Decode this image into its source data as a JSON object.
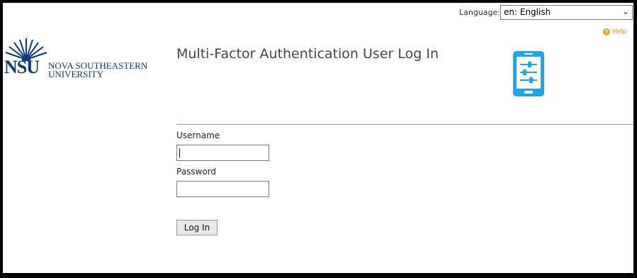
{
  "language": {
    "label": "Language:",
    "selected": "en: English"
  },
  "help": {
    "label": "Help"
  },
  "logo": {
    "abbr": "NSU",
    "line1": "NOVA SOUTHEASTERN",
    "line2": "UNIVERSITY"
  },
  "page": {
    "title": "Multi-Factor Authentication User Log In"
  },
  "form": {
    "username_label": "Username",
    "username_value": "",
    "password_label": "Password",
    "password_value": "",
    "login_label": "Log In"
  },
  "colors": {
    "brand": "#0b3a7d",
    "device_icon": "#1ea7e6",
    "help": "#e8900b"
  }
}
